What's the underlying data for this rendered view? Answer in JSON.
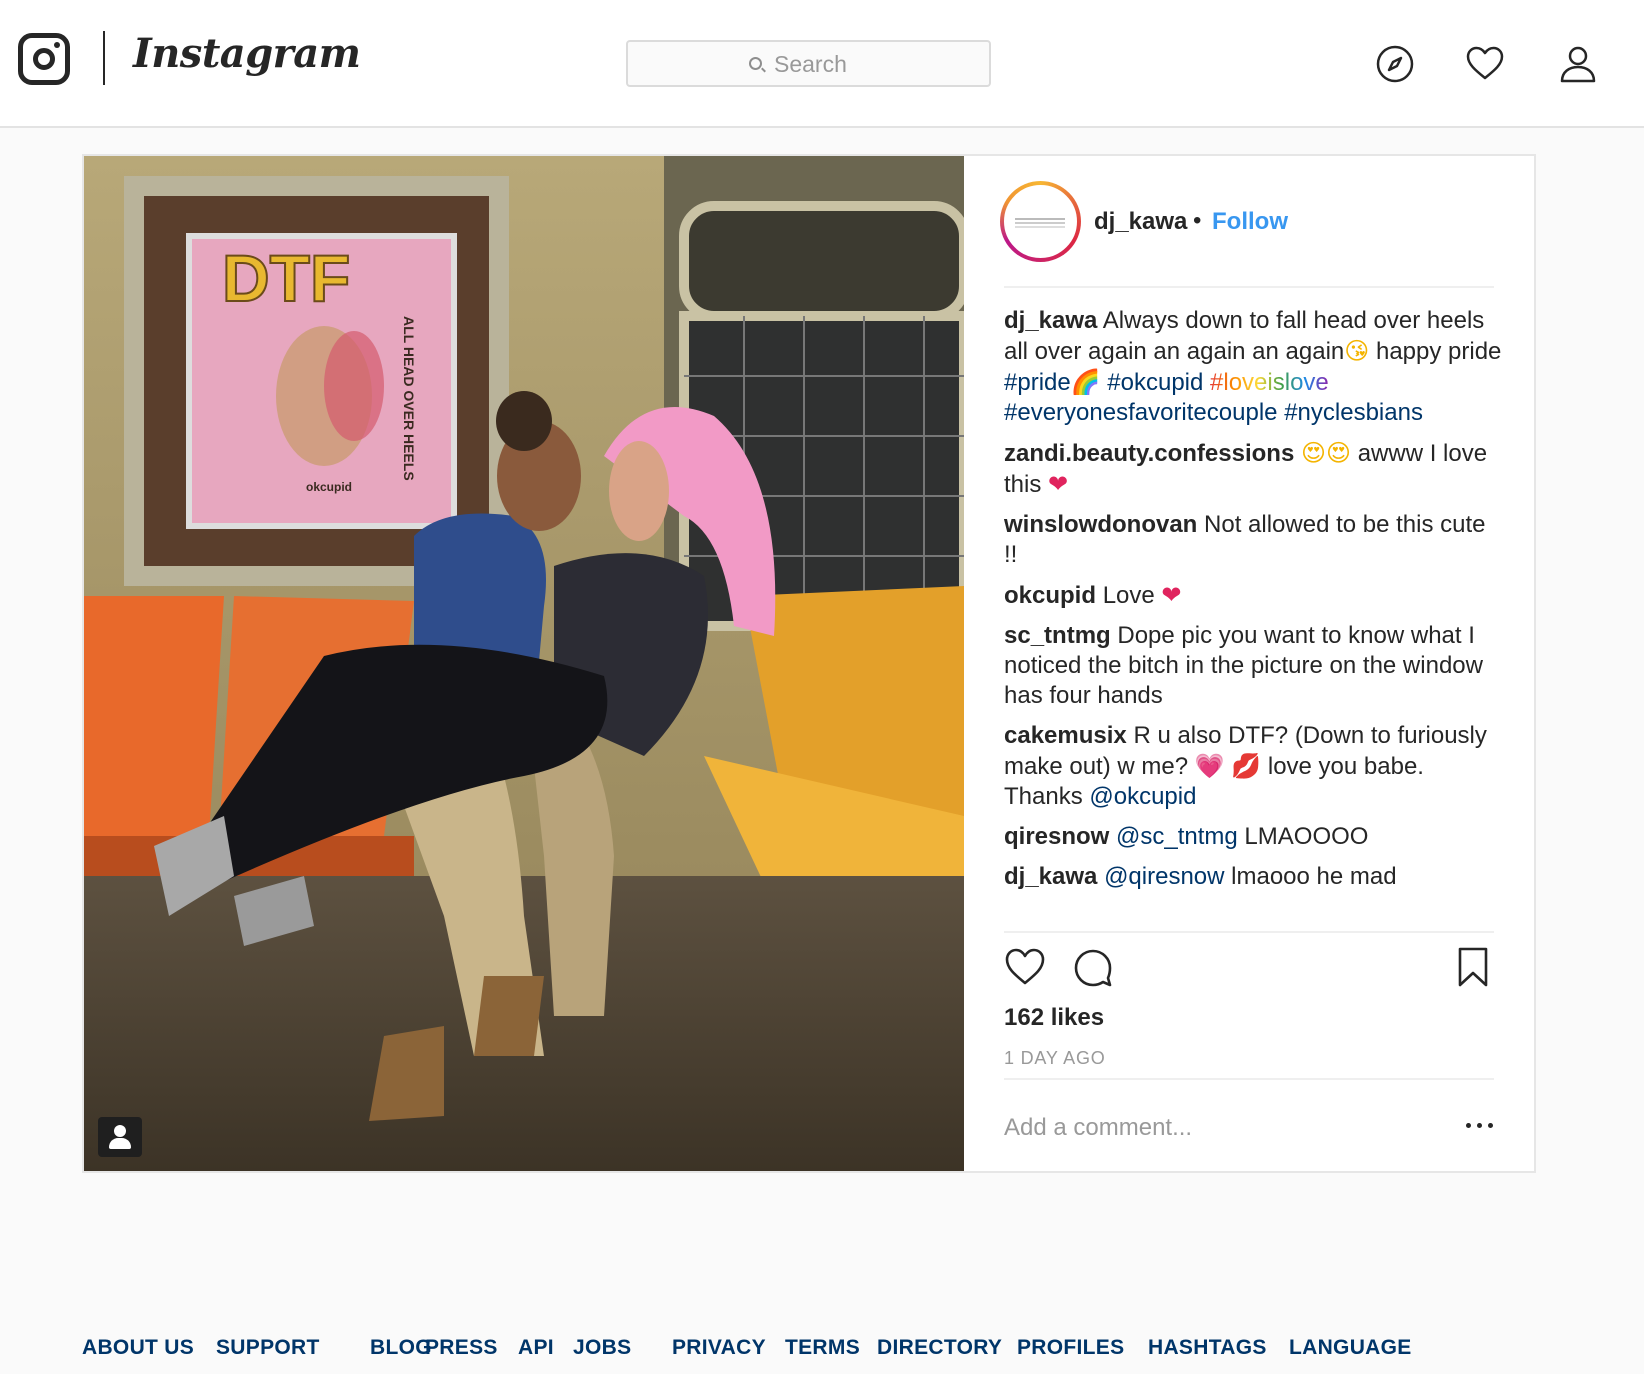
{
  "header": {
    "brand": "Instagram",
    "search_placeholder": "Search"
  },
  "post": {
    "author": "dj_kawa",
    "separator": "•",
    "follow_label": "Follow",
    "comments": [
      {
        "user": "dj_kawa",
        "parts": [
          {
            "t": "text",
            "v": "Always down to fall head over heels all over again an again an again"
          },
          {
            "t": "emoji",
            "v": "😘",
            "c": "gold"
          },
          {
            "t": "text",
            "v": " happy pride "
          },
          {
            "t": "tag",
            "v": "#pride"
          },
          {
            "t": "emoji",
            "v": "🌈",
            "c": "pink"
          },
          {
            "t": "text",
            "v": " "
          },
          {
            "t": "tag",
            "v": "#okcupid"
          },
          {
            "t": "text",
            "v": " "
          },
          {
            "t": "rainbow",
            "v": "#loveislove"
          },
          {
            "t": "text",
            "v": " "
          },
          {
            "t": "tag",
            "v": "#everyonesfavoritecouple"
          },
          {
            "t": "text",
            "v": " "
          },
          {
            "t": "tag",
            "v": "#nyclesbians"
          }
        ]
      },
      {
        "user": "zandi.beauty.confessions",
        "parts": [
          {
            "t": "emoji",
            "v": "😍",
            "c": "gold"
          },
          {
            "t": "emoji",
            "v": "😍",
            "c": "gold"
          },
          {
            "t": "text",
            "v": " awww I love this "
          },
          {
            "t": "emoji",
            "v": "❤",
            "c": "red"
          }
        ]
      },
      {
        "user": "winslowdonovan",
        "parts": [
          {
            "t": "text",
            "v": "Not allowed to be this cute !!"
          }
        ]
      },
      {
        "user": "okcupid",
        "parts": [
          {
            "t": "text",
            "v": "Love "
          },
          {
            "t": "emoji",
            "v": "❤",
            "c": "red"
          }
        ]
      },
      {
        "user": "sc_tntmg",
        "parts": [
          {
            "t": "text",
            "v": "Dope pic you want to know what I noticed the bitch in the picture on the window has four hands"
          }
        ]
      },
      {
        "user": "cakemusix",
        "parts": [
          {
            "t": "text",
            "v": "R u also DTF? (Down to furiously make out) w me? "
          },
          {
            "t": "emoji",
            "v": "💗",
            "c": "pink"
          },
          {
            "t": "text",
            "v": " "
          },
          {
            "t": "emoji",
            "v": "💋",
            "c": "red"
          },
          {
            "t": "text",
            "v": " love you babe. Thanks "
          },
          {
            "t": "tag",
            "v": "@okcupid"
          }
        ]
      },
      {
        "user": "qiresnow",
        "parts": [
          {
            "t": "tag",
            "v": "@sc_tntmg"
          },
          {
            "t": "text",
            "v": " LMAOOOO"
          }
        ]
      },
      {
        "user": "dj_kawa",
        "parts": [
          {
            "t": "tag",
            "v": "@qiresnow"
          },
          {
            "t": "text",
            "v": " lmaooo he mad"
          }
        ]
      }
    ],
    "likes": "162 likes",
    "timestamp": "1 DAY AGO",
    "add_comment_placeholder": "Add a comment..."
  },
  "poster": {
    "headline": "DTF",
    "side_text": "ALL HEAD OVER HEELS",
    "brand": "okcupid"
  },
  "footer": {
    "links": [
      "ABOUT US",
      "SUPPORT",
      "BLOG",
      "PRESS",
      "API",
      "JOBS",
      "PRIVACY",
      "TERMS",
      "DIRECTORY",
      "PROFILES",
      "HASHTAGS",
      "LANGUAGE"
    ]
  },
  "colors": {
    "link": "#003569",
    "follow": "#3897f0",
    "background": "#fafafa"
  }
}
